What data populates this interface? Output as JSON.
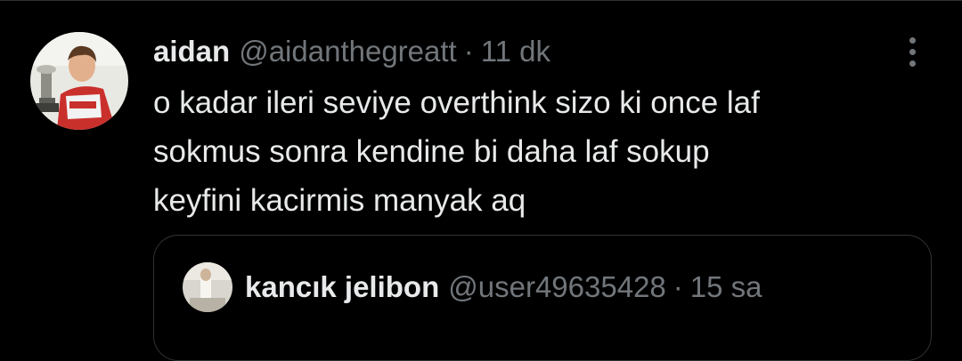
{
  "tweet": {
    "author": {
      "display_name": "aidan",
      "handle": "@aidanthegreatt",
      "avatar_icon": "profile-photo-trophy-boy"
    },
    "separator": "·",
    "timestamp": "11 dk",
    "text": "o kadar ileri seviye overthink sizo ki once laf\nsokmus sonra kendine bi daha laf sokup\nkeyfini kacirmis manyak aq",
    "more_icon": "more-vertical-icon"
  },
  "quoted_tweet": {
    "author": {
      "display_name": "kancık jelibon",
      "handle": "@user49635428",
      "avatar_icon": "profile-photo-figure"
    },
    "separator": "·",
    "timestamp": "15 sa"
  },
  "colors": {
    "background": "#000000",
    "primary_text": "#e7e9ea",
    "secondary_text": "#71767b",
    "border": "#2f3336"
  }
}
